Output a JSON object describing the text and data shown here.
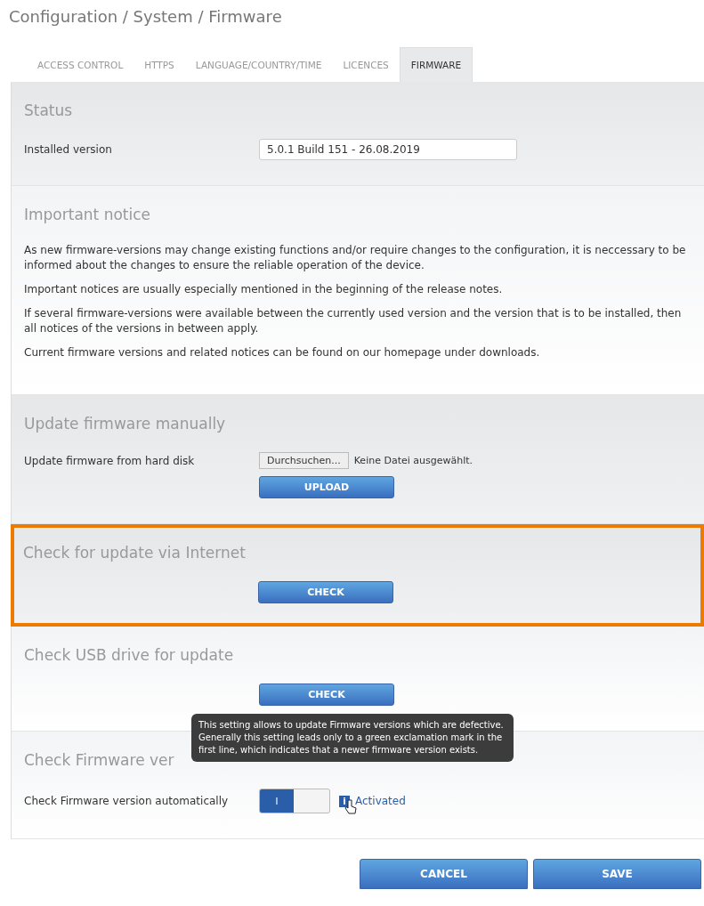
{
  "breadcrumb": "Configuration / System / Firmware",
  "tabs": [
    {
      "label": "ACCESS CONTROL",
      "selected": false
    },
    {
      "label": "HTTPS",
      "selected": false
    },
    {
      "label": "LANGUAGE/COUNTRY/TIME",
      "selected": false
    },
    {
      "label": "LICENCES",
      "selected": false
    },
    {
      "label": "FIRMWARE",
      "selected": true
    }
  ],
  "sections": [
    {
      "kind": "field",
      "title": "Status",
      "highlighted": false,
      "label": "Installed version",
      "value": "5.0.1 Build 151 - 26.08.2019"
    },
    {
      "kind": "notice",
      "title": "Important notice",
      "highlighted": false,
      "paragraphs": [
        "As new firmware-versions may change existing functions and/or require changes to the configuration, it is neccessary to be informed about the changes to ensure the reliable operation of the device.",
        "Important notices are usually especially mentioned in the beginning of the release notes.",
        "If several firmware-versions were available between the currently used version and the version that is to be installed, then all notices of the versions in between apply.",
        "Current firmware versions and related notices can be found on our homepage under downloads."
      ]
    },
    {
      "kind": "upload",
      "title": "Update firmware manually",
      "highlighted": false,
      "label": "Update firmware from hard disk",
      "browse": "Durchsuchen...",
      "file_status": "Keine Datei ausgewählt.",
      "button": "UPLOAD"
    },
    {
      "kind": "action",
      "title": "Check for update via Internet",
      "highlighted": true,
      "button": "CHECK"
    },
    {
      "kind": "action",
      "title": "Check USB drive for update",
      "highlighted": false,
      "button": "CHECK"
    },
    {
      "kind": "toggle",
      "title": "Check Firmware ver",
      "highlighted": false,
      "label": "Check Firmware version automatically",
      "on": true,
      "switch_text": "I",
      "info": "i",
      "status": "Activated",
      "tooltip": "This setting allows to update Firmware versions which are defective. Generally this setting leads only to a green exclamation mark in the first line, which indicates that a newer firmware version exists."
    }
  ],
  "buttons": [
    "CANCEL",
    "SAVE"
  ]
}
